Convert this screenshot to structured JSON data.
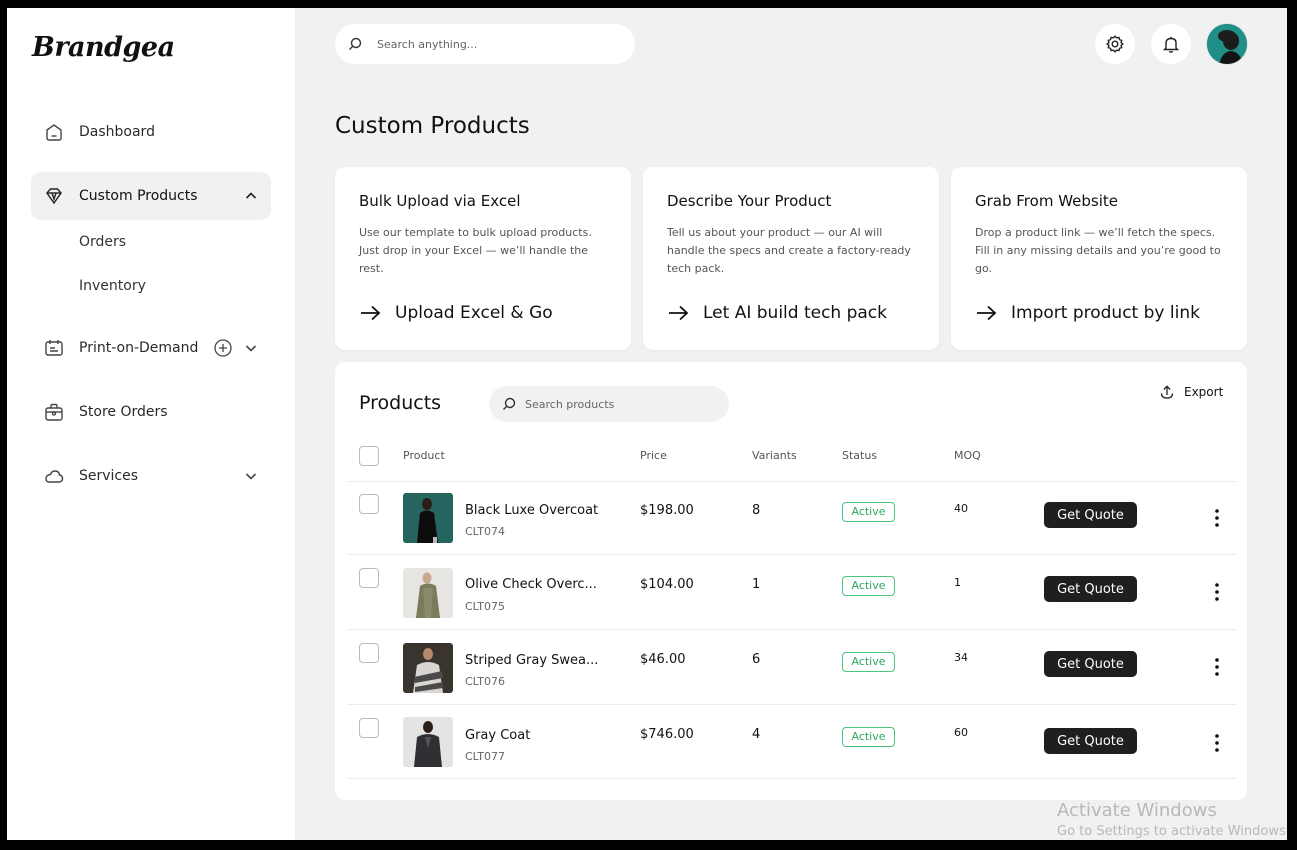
{
  "brand": "Brandgea",
  "sidebar": {
    "items": [
      {
        "label": "Dashboard",
        "icon": "home-icon"
      },
      {
        "label": "Custom Products",
        "icon": "diamond-icon",
        "expanded": true,
        "children": [
          "Orders",
          "Inventory"
        ]
      },
      {
        "label": "Print-on-Demand",
        "icon": "print-icon"
      },
      {
        "label": "Store Orders",
        "icon": "bag-icon"
      },
      {
        "label": "Services",
        "icon": "cloud-icon"
      }
    ]
  },
  "topbar": {
    "search_placeholder": "Search anything...",
    "icons": [
      "settings-gear-icon",
      "bell-icon",
      "user-avatar"
    ]
  },
  "page_title": "Custom Products",
  "cards": [
    {
      "title": "Bulk Upload via Excel",
      "desc": "Use our template to bulk upload products. Just drop in your Excel — we’ll handle the rest.",
      "action": "Upload Excel & Go"
    },
    {
      "title": "Describe Your Product",
      "desc": "Tell us about your product — our AI will handle the specs and create a factory-ready tech pack.",
      "action": "Let AI build tech pack"
    },
    {
      "title": "Grab From Website",
      "desc": "Drop a product link — we’ll fetch the specs. Fill in any missing details and you’re good to go.",
      "action": "Import product by link"
    }
  ],
  "products": {
    "title": "Products",
    "search_placeholder": "Search products",
    "export_label": "Export",
    "columns": [
      "Product",
      "Price",
      "Variants",
      "Status",
      "MOQ"
    ],
    "quote_label": "Get Quote",
    "rows": [
      {
        "name": "Black Luxe Overcoat",
        "sku": "CLT074",
        "price": "$198.00",
        "variants": "8",
        "status": "Active",
        "moq": "40"
      },
      {
        "name": "Olive Check Overc...",
        "sku": "CLT075",
        "price": "$104.00",
        "variants": "1",
        "status": "Active",
        "moq": "1"
      },
      {
        "name": "Striped Gray Swea...",
        "sku": "CLT076",
        "price": "$46.00",
        "variants": "6",
        "status": "Active",
        "moq": "34"
      },
      {
        "name": "Gray Coat",
        "sku": "CLT077",
        "price": "$746.00",
        "variants": "4",
        "status": "Active",
        "moq": "60"
      }
    ]
  },
  "watermark": {
    "line1": "Activate Windows",
    "line2": "Go to Settings to activate Windows."
  },
  "colors": {
    "accent_green": "#2fa860",
    "button_dark": "#1f1f1f",
    "background": "#f1f1f1"
  }
}
